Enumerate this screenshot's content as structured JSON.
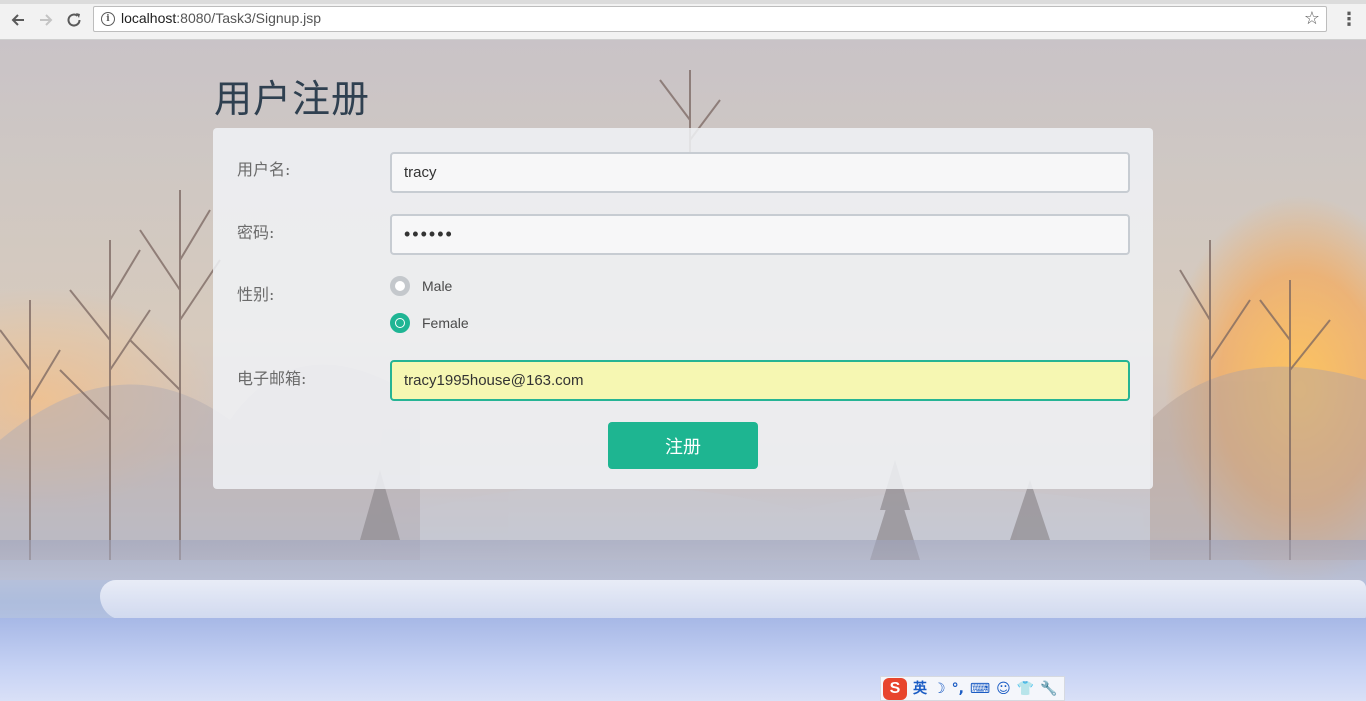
{
  "browser": {
    "url_host": "localhost",
    "url_path": ":8080/Task3/Signup.jsp",
    "back_icon": "arrow-left-icon",
    "forward_icon": "arrow-right-icon",
    "reload_icon": "reload-icon",
    "info_icon": "i",
    "star_icon": "☆",
    "menu_icon": "⋮"
  },
  "form": {
    "title": "用户注册",
    "username_label": "用户名:",
    "username_value": "tracy",
    "password_label": "密码:",
    "password_value": "••••••",
    "gender_label": "性别:",
    "gender_options": [
      {
        "label": "Male",
        "checked": false
      },
      {
        "label": "Female",
        "checked": true
      }
    ],
    "email_label": "电子邮箱:",
    "email_value": "tracy1995house@163.com",
    "submit_label": "注册"
  },
  "ime_toolbar": {
    "logo": "S",
    "lang": "英",
    "items": [
      "☽",
      "°,",
      "⌨",
      "☺",
      "👕",
      "🔧"
    ]
  },
  "colors": {
    "accent": "#1eb591",
    "title": "#2f4050",
    "focus_bg": "#f6f7b2"
  }
}
